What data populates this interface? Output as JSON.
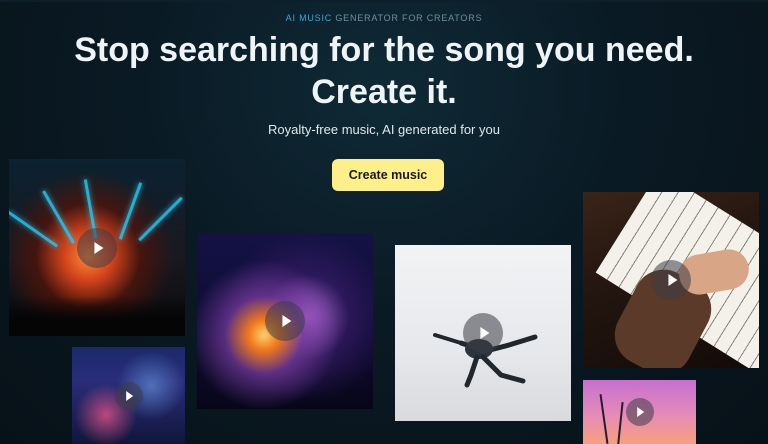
{
  "hero": {
    "eyebrow_accent": "AI MUSIC",
    "eyebrow_rest": " GENERATOR FOR CREATORS",
    "headline_line1": "Stop searching for the song you need.",
    "headline_line2": "Create it.",
    "subtitle": "Royalty-free music, AI generated for you",
    "cta_label": "Create music"
  },
  "colors": {
    "cta_background": "#fdf08a",
    "eyebrow_accent": "#3aa7d8",
    "page_background": "#0a1a24"
  },
  "tiles": [
    {
      "name": "concert",
      "icon": "play-icon"
    },
    {
      "name": "city-night",
      "icon": "play-icon"
    },
    {
      "name": "disco-ball",
      "icon": "play-icon"
    },
    {
      "name": "dancer",
      "icon": "play-icon"
    },
    {
      "name": "piano",
      "icon": "play-icon"
    },
    {
      "name": "palm-trees",
      "icon": "play-icon"
    }
  ]
}
